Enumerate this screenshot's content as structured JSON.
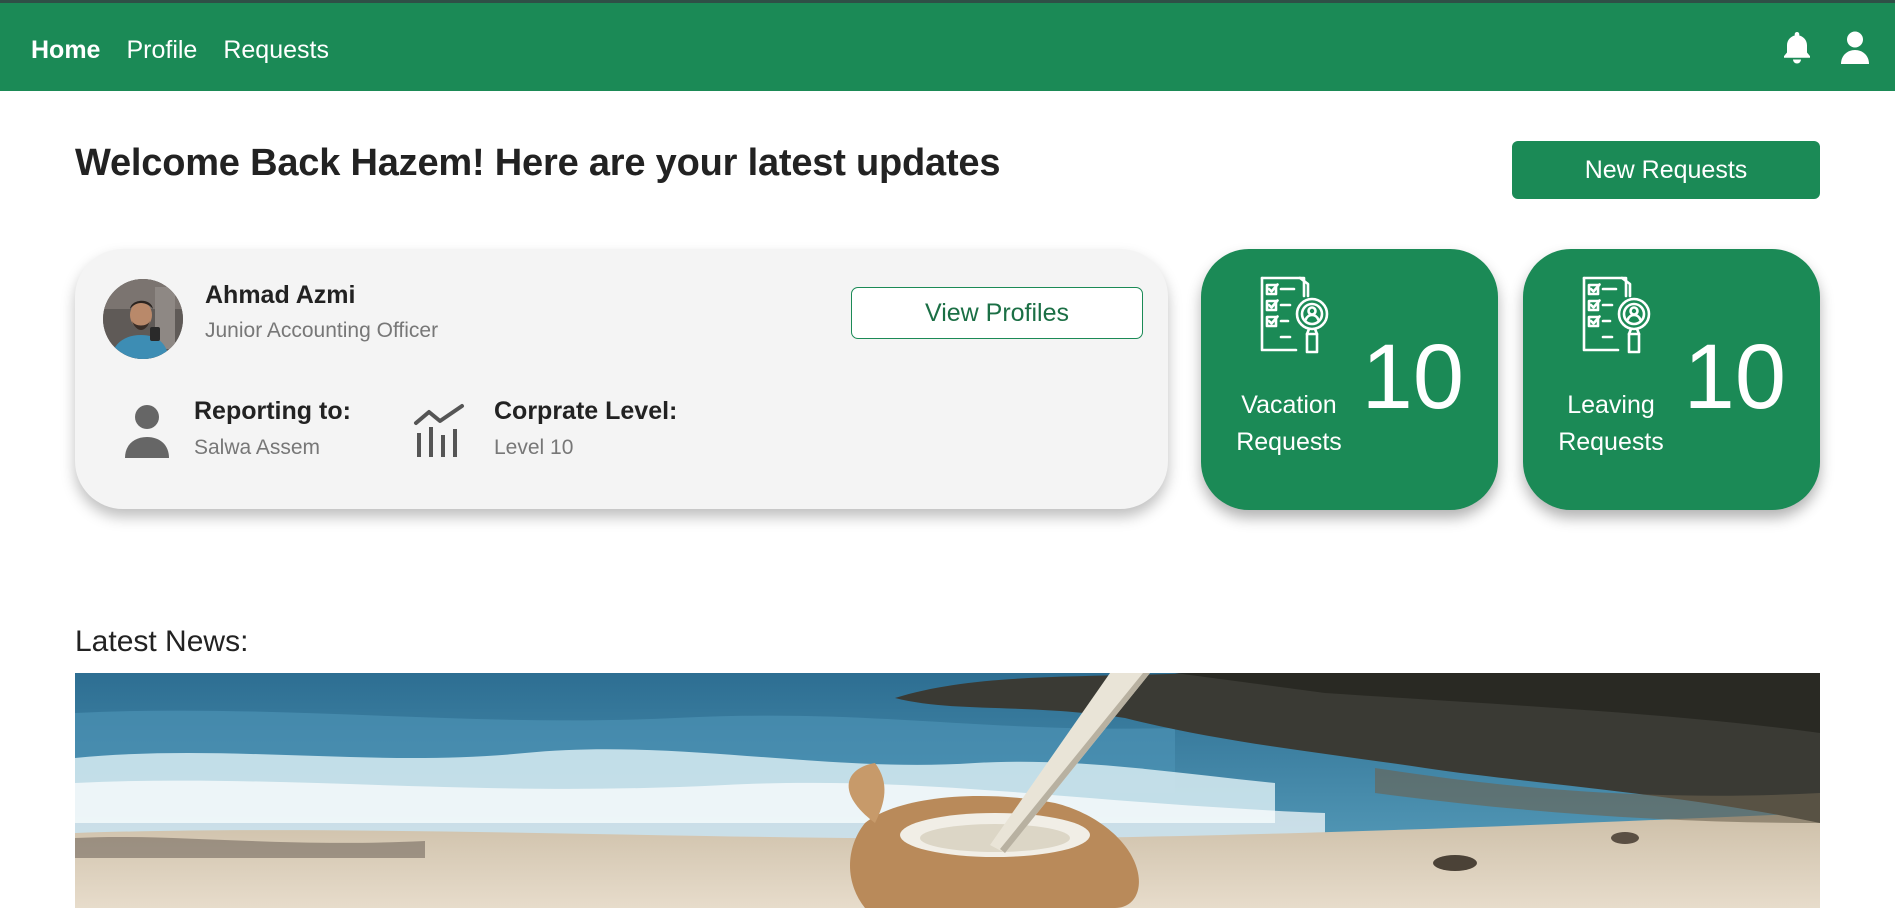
{
  "nav": {
    "items": [
      {
        "label": "Home",
        "active": true
      },
      {
        "label": "Profile",
        "active": false
      },
      {
        "label": "Requests",
        "active": false
      }
    ],
    "icons": [
      "bell-icon",
      "user-icon"
    ]
  },
  "header": {
    "welcome": "Welcome Back Hazem! Here are your latest updates",
    "new_requests_label": "New Requests"
  },
  "profile_card": {
    "name": "Ahmad Azmi",
    "title": "Junior Accounting Officer",
    "view_profiles_label": "View Profiles",
    "reporting_label": "Reporting to:",
    "reporting_value": "Salwa Assem",
    "level_label": "Corprate Level:",
    "level_value": "Level 10"
  },
  "stats": [
    {
      "label_line1": "Vacation",
      "label_line2": "Requests",
      "count": "10"
    },
    {
      "label_line1": "Leaving",
      "label_line2": "Requests",
      "count": "10"
    }
  ],
  "news": {
    "title": "Latest News:"
  },
  "colors": {
    "brand_green": "#1b8a56",
    "card_gray": "#f4f4f4",
    "muted_text": "#777777"
  }
}
